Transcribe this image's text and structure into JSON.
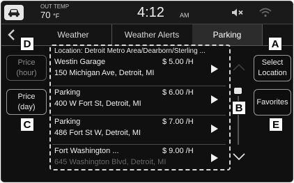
{
  "status": {
    "out_temp_label": "OUT TEMP",
    "out_temp_value": "70",
    "out_temp_unit": "°F",
    "time": "4:12",
    "ampm": "AM"
  },
  "tabs": [
    {
      "label": "Weather",
      "active": false
    },
    {
      "label": "Weather Alerts",
      "active": false
    },
    {
      "label": "Parking",
      "active": true
    }
  ],
  "left_buttons": {
    "price_hour": [
      "Price",
      "(hour)"
    ],
    "price_day": [
      "Price",
      "(day)"
    ]
  },
  "right_buttons": {
    "select_location": [
      "Select",
      "Location"
    ],
    "favorites": "Favorites"
  },
  "location_line": "Location:  Detroit Metro Area/Dearborn/Sterling ...",
  "results": [
    {
      "name": "Westin Garage",
      "price": "$ 5.00 /H",
      "address": "150 Michigan Ave, Detroit, MI"
    },
    {
      "name": "Parking",
      "price": "$ 6.00 /H",
      "address": "400 W Fort St, Detroit, MI"
    },
    {
      "name": "Parking",
      "price": "$ 7.00 /H",
      "address": "486 Fort St W, Detroit, MI"
    },
    {
      "name": "Fort Washington ...",
      "price": "$ 9.00 /H",
      "address": "645 Washington Blvd, Detroit, MI"
    }
  ],
  "callouts": {
    "a": "A",
    "b": "B",
    "c": "C",
    "d": "D",
    "e": "E"
  },
  "colors": {
    "background": "#101010",
    "text": "#f0f0f0",
    "callout_bg": "#ffffff"
  },
  "icons": [
    "car-icon",
    "mute-icon",
    "wifi-icon",
    "back-arrow-icon",
    "play-arrow-icon",
    "chevron-up-icon",
    "chevron-down-icon"
  ]
}
